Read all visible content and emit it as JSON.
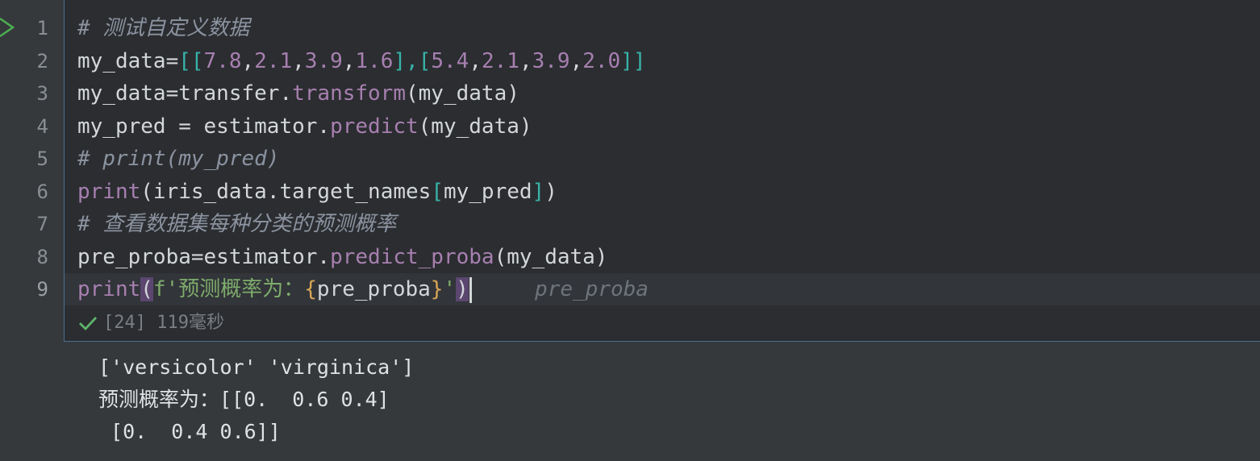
{
  "gutter": {
    "line_numbers": [
      "1",
      "2",
      "3",
      "4",
      "5",
      "6",
      "7",
      "8",
      "9"
    ]
  },
  "code": {
    "line1": "# 测试自定义数据",
    "line2": {
      "a": "my_data=",
      "b": "[[",
      "n1": "7.8",
      ",1": ",",
      "n2": "2.1",
      ",2": ",",
      "n3": "3.9",
      ",3": ",",
      "n4": "1.6",
      "c": "],[",
      "n5": "5.4",
      ",4": ",",
      "n6": "2.1",
      ",5": ",",
      "n7": "3.9",
      ",6": ",",
      "n8": "2.0",
      "d": "]]"
    },
    "line3": {
      "a": "my_data=transfer.",
      "fn": "transform",
      "b": "(my_data)"
    },
    "line4": {
      "a": "my_pred = estimator.",
      "fn": "predict",
      "b": "(my_data)"
    },
    "line5": "# print(my_pred)",
    "line6": {
      "fn": "print",
      "a": "(iris_data.target_names",
      "b": "[",
      "c": "my_pred",
      "d": "]",
      "e": ")"
    },
    "line7": "# 查看数据集每种分类的预测概率",
    "line8": {
      "a": "pre_proba=estimator.",
      "fn": "predict_proba",
      "b": "(my_data)"
    },
    "line9": {
      "fn": "print",
      "open": "(",
      "s1": "f'预测概率为：",
      "lb": "{",
      "v": "pre_proba",
      "rb": "}",
      "s2": "'",
      "close": ")",
      "hint": "pre_proba"
    }
  },
  "status": {
    "exec_count": "[24]",
    "duration": "119毫秒"
  },
  "output": {
    "lines": [
      "['versicolor' 'virginica']",
      "预测概率为：[[0.  0.6 0.4]",
      " [0.  0.4 0.6]]"
    ]
  },
  "colors": {
    "run_arrow": "#4caf50",
    "check": "#5fb36b"
  }
}
